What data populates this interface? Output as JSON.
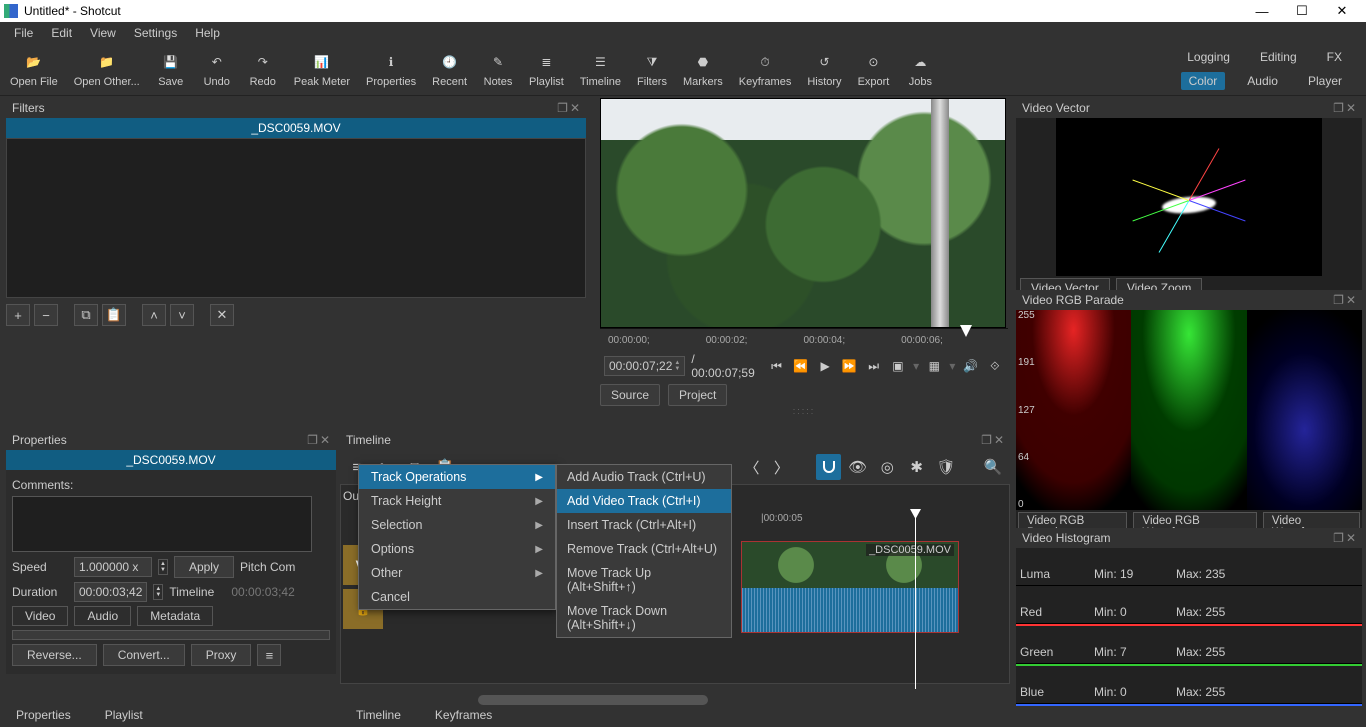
{
  "window": {
    "title": "Untitled* - Shotcut"
  },
  "menubar": [
    "File",
    "Edit",
    "View",
    "Settings",
    "Help"
  ],
  "toolbar": [
    {
      "id": "open-file",
      "label": "Open File"
    },
    {
      "id": "open-other",
      "label": "Open Other..."
    },
    {
      "id": "save",
      "label": "Save"
    },
    {
      "id": "undo",
      "label": "Undo"
    },
    {
      "id": "redo",
      "label": "Redo"
    },
    {
      "id": "peak-meter",
      "label": "Peak Meter"
    },
    {
      "id": "properties",
      "label": "Properties"
    },
    {
      "id": "recent",
      "label": "Recent"
    },
    {
      "id": "notes",
      "label": "Notes"
    },
    {
      "id": "playlist",
      "label": "Playlist"
    },
    {
      "id": "timeline",
      "label": "Timeline"
    },
    {
      "id": "filters",
      "label": "Filters"
    },
    {
      "id": "markers",
      "label": "Markers"
    },
    {
      "id": "keyframes",
      "label": "Keyframes"
    },
    {
      "id": "history",
      "label": "History"
    },
    {
      "id": "export",
      "label": "Export"
    },
    {
      "id": "jobs",
      "label": "Jobs"
    }
  ],
  "layout_tabs": {
    "row1": [
      "Logging",
      "Editing",
      "FX"
    ],
    "row2": [
      "Color",
      "Audio",
      "Player"
    ],
    "selected": "Color"
  },
  "filters": {
    "title": "Filters",
    "clip": "_DSC0059.MOV"
  },
  "player": {
    "ruler": [
      "00:00:00;",
      "00:00:02;",
      "00:00:04;",
      "00:00:06;"
    ],
    "tc": "00:00:07;22",
    "dur": "/ 00:00:07;59",
    "tabs": [
      "Source",
      "Project"
    ]
  },
  "properties": {
    "title": "Properties",
    "clip": "_DSC0059.MOV",
    "comments_label": "Comments:",
    "speed_label": "Speed",
    "speed_value": "1.000000 x",
    "apply": "Apply",
    "pitch": "Pitch Com",
    "duration_label": "Duration",
    "duration_value": "00:00:03;42",
    "timeline_label": "Timeline",
    "timeline_value": "00:00:03;42",
    "tabs": [
      "Video",
      "Audio",
      "Metadata"
    ],
    "buttons": [
      "Reverse...",
      "Convert...",
      "Proxy"
    ]
  },
  "timeline": {
    "title": "Timeline",
    "ruler": "|00:00:05",
    "track": "V1",
    "clip": "_DSC0059.MOV",
    "output": "Ou"
  },
  "context_menu": {
    "cat": [
      {
        "label": "Track Operations",
        "sub": true,
        "hi": true
      },
      {
        "label": "Track Height",
        "sub": true
      },
      {
        "label": "Selection",
        "sub": true
      },
      {
        "label": "Options",
        "sub": true
      },
      {
        "label": "Other",
        "sub": true
      },
      {
        "label": "Cancel"
      }
    ],
    "sub": [
      {
        "label": "Add Audio Track (Ctrl+U)"
      },
      {
        "label": "Add Video Track (Ctrl+I)",
        "hi": true
      },
      {
        "label": "Insert Track (Ctrl+Alt+I)"
      },
      {
        "label": "Remove Track (Ctrl+Alt+U)"
      },
      {
        "label": "Move Track Up (Alt+Shift+↑)"
      },
      {
        "label": "Move Track Down (Alt+Shift+↓)"
      }
    ]
  },
  "scopes": {
    "video_vector": {
      "title": "Video Vector",
      "tabs": [
        "Video Vector",
        "Video Zoom"
      ]
    },
    "rgb_parade": {
      "title": "Video RGB Parade",
      "ylabels": [
        "255",
        "191",
        "127",
        "64",
        "0"
      ],
      "tabs": [
        "Video RGB Parade",
        "Video RGB Waveform",
        "Video Waveform"
      ]
    },
    "histogram": {
      "title": "Video Histogram",
      "rows": [
        {
          "name": "Luma",
          "min": "Min: 19",
          "max": "Max: 235"
        },
        {
          "name": "Red",
          "min": "Min: 0",
          "max": "Max: 255"
        },
        {
          "name": "Green",
          "min": "Min: 7",
          "max": "Max: 255"
        },
        {
          "name": "Blue",
          "min": "Min: 0",
          "max": "Max: 255"
        }
      ]
    }
  },
  "bottom_tabs_left": [
    "Properties",
    "Playlist"
  ],
  "bottom_tabs_mid": [
    "Timeline",
    "Keyframes"
  ]
}
